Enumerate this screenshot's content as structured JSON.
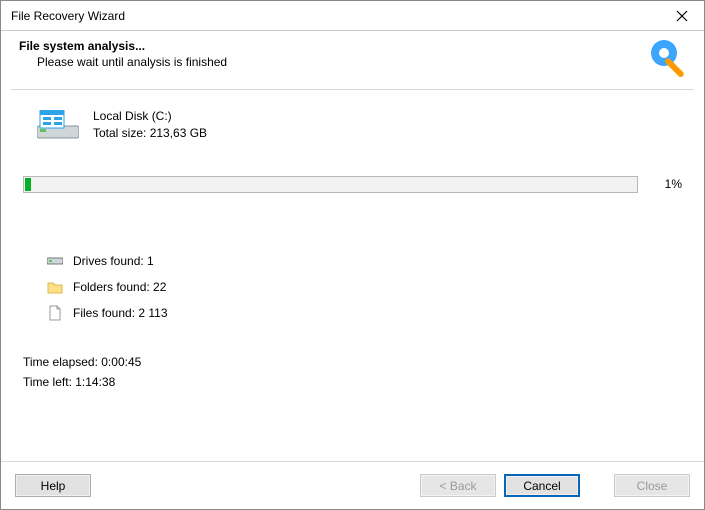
{
  "window": {
    "title": "File Recovery Wizard"
  },
  "header": {
    "title": "File system analysis...",
    "subtitle": "Please wait until analysis is finished"
  },
  "disk": {
    "name": "Local Disk (C:)",
    "size_label": "Total size: 213,63 GB"
  },
  "progress": {
    "percent_text": "1%",
    "percent_value": 1
  },
  "stats": {
    "drives_label": "Drives found: 1",
    "folders_label": "Folders found: 22",
    "files_label": "Files found: 2 113"
  },
  "time": {
    "elapsed_label": "Time elapsed: 0:00:45",
    "left_label": "Time left: 1:14:38"
  },
  "buttons": {
    "help": "Help",
    "back": "< Back",
    "cancel": "Cancel",
    "close": "Close"
  }
}
